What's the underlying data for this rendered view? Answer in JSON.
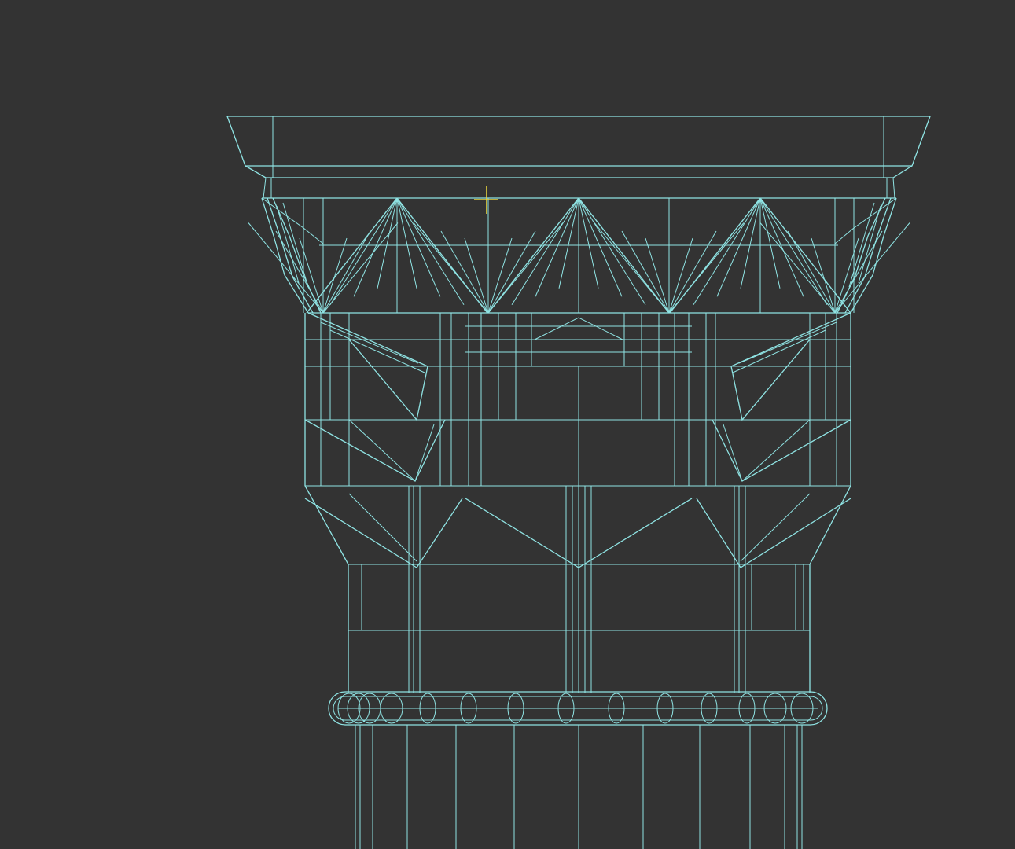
{
  "viewport": {
    "background_color": "#333333",
    "wire_color": "#8fe3e3",
    "cursor_color": "#e6d23c",
    "render_mode": "wireframe"
  },
  "model": {
    "parts": [
      "abacus",
      "frieze-triangles",
      "capital-body",
      "astragal-ring",
      "column-shaft"
    ]
  }
}
